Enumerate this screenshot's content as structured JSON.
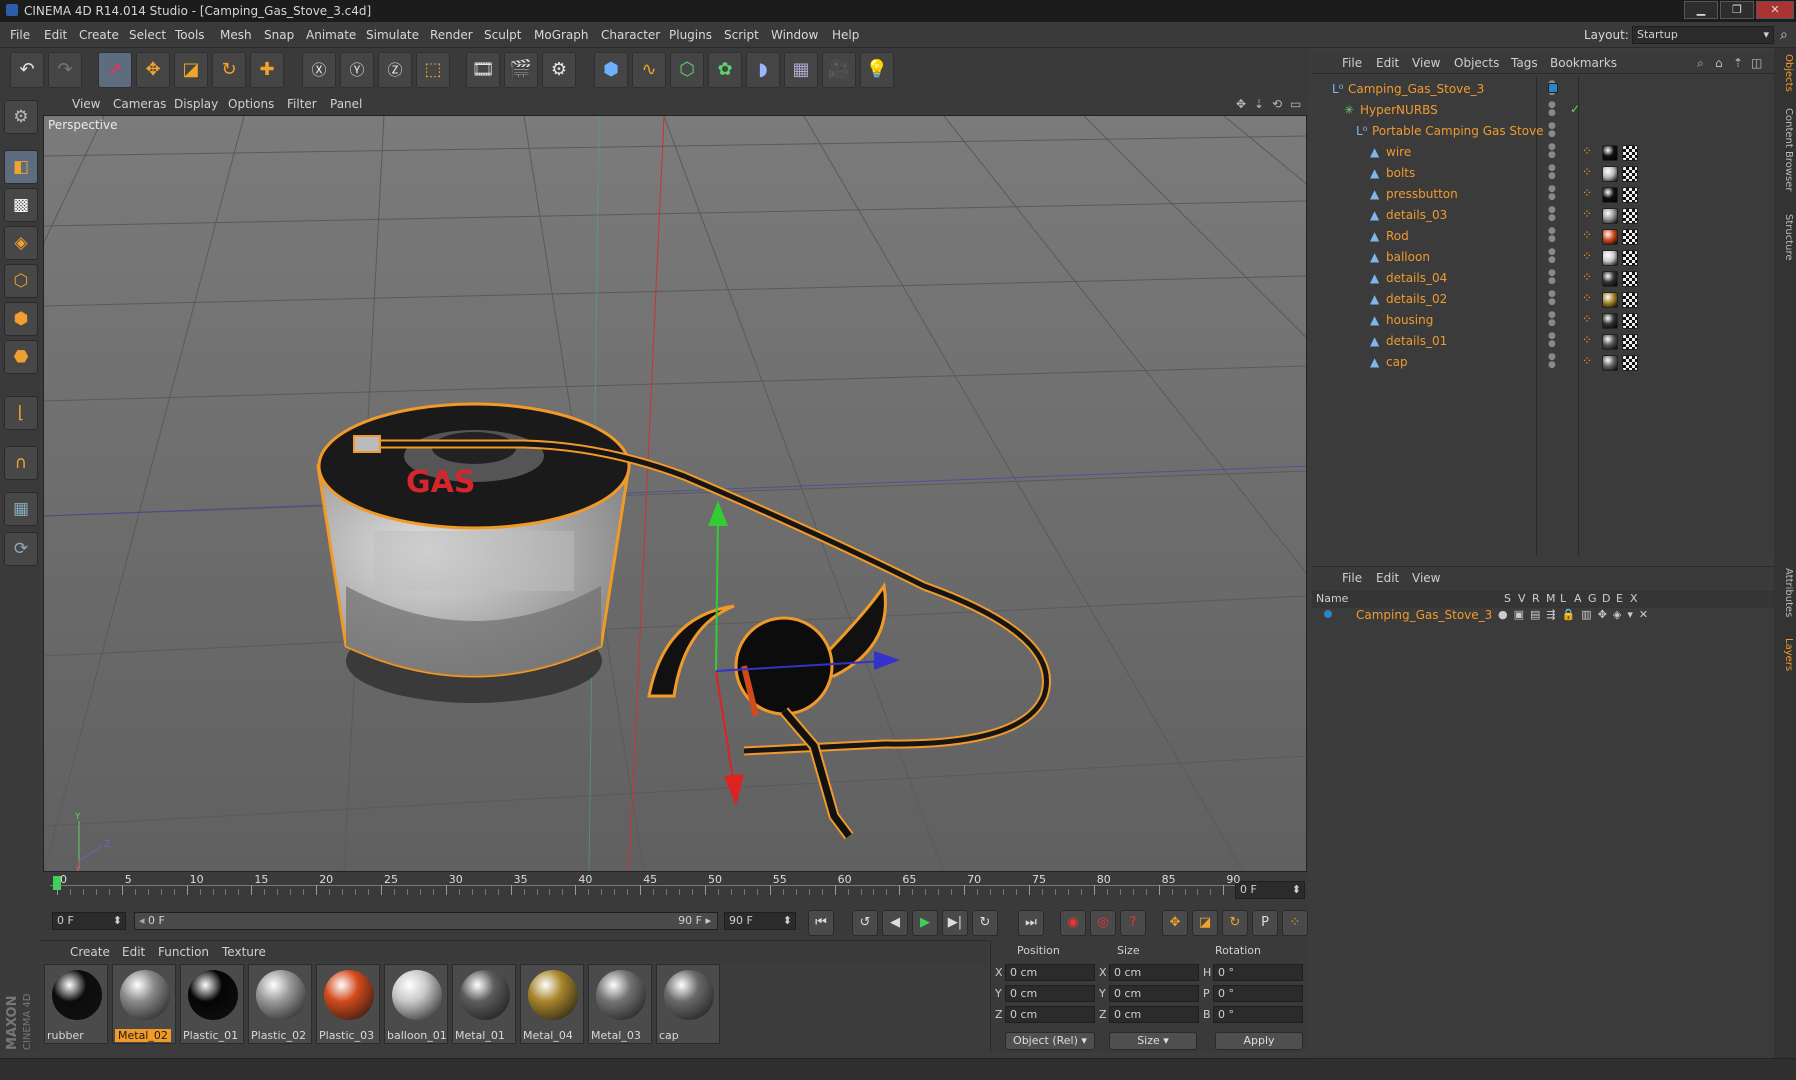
{
  "window": {
    "title": "CINEMA 4D R14.014 Studio - [Camping_Gas_Stove_3.c4d]",
    "layout_label": "Layout:",
    "layout_value": "Startup"
  },
  "menubar": [
    "File",
    "Edit",
    "Create",
    "Select",
    "Tools",
    "Mesh",
    "Snap",
    "Animate",
    "Simulate",
    "Render",
    "Sculpt",
    "MoGraph",
    "Character",
    "Plugins",
    "Script",
    "Window",
    "Help"
  ],
  "viewport": {
    "menu": [
      "View",
      "Cameras",
      "Display",
      "Options",
      "Filter",
      "Panel"
    ],
    "label": "Perspective",
    "can_text": "GAS",
    "axis_y": "Y",
    "axis_z": "Z",
    "axis_x": "X"
  },
  "timeline": {
    "ticks": [
      "0",
      "5",
      "10",
      "15",
      "20",
      "25",
      "30",
      "35",
      "40",
      "45",
      "50",
      "55",
      "60",
      "65",
      "70",
      "75",
      "80",
      "85",
      "90"
    ],
    "current_frame": "0 F",
    "start_frame": "0 F",
    "range_start": "0 F",
    "range_end": "90 F",
    "end_frame": "90 F"
  },
  "materials": {
    "menu": [
      "Create",
      "Edit",
      "Function",
      "Texture"
    ],
    "items": [
      {
        "name": "rubber",
        "color": "#0c0c0c",
        "selected": false
      },
      {
        "name": "Metal_02",
        "color": "#8a8a8a",
        "selected": true
      },
      {
        "name": "Plastic_01",
        "color": "#050505",
        "selected": false
      },
      {
        "name": "Plastic_02",
        "color": "#9a9a9a",
        "selected": false
      },
      {
        "name": "Plastic_03",
        "color": "#d24a1c",
        "selected": false
      },
      {
        "name": "balloon_01",
        "color": "#c9c9c9",
        "selected": false
      },
      {
        "name": "Metal_01",
        "color": "#5c5c5c",
        "selected": false
      },
      {
        "name": "Metal_04",
        "color": "#a8852a",
        "selected": false
      },
      {
        "name": "Metal_03",
        "color": "#737373",
        "selected": false
      },
      {
        "name": "cap",
        "color": "#6a6a6a",
        "selected": false
      }
    ]
  },
  "coordinates": {
    "headers": [
      "Position",
      "Size",
      "Rotation"
    ],
    "rows": [
      {
        "axis": "X",
        "pos": "0 cm",
        "saxis": "X",
        "size": "0 cm",
        "raxis": "H",
        "rot": "0 °"
      },
      {
        "axis": "Y",
        "pos": "0 cm",
        "saxis": "Y",
        "size": "0 cm",
        "raxis": "P",
        "rot": "0 °"
      },
      {
        "axis": "Z",
        "pos": "0 cm",
        "saxis": "Z",
        "size": "0 cm",
        "raxis": "B",
        "rot": "0 °"
      }
    ],
    "mode": "Object (Rel)",
    "size_mode": "Size",
    "apply": "Apply"
  },
  "object_manager": {
    "menu": [
      "File",
      "Edit",
      "View",
      "Objects",
      "Tags",
      "Bookmarks"
    ],
    "objects": [
      {
        "name": "Camping_Gas_Stove_3",
        "tag": ""
      },
      {
        "name": "HyperNURBS",
        "tag": ""
      },
      {
        "name": "Portable Camping Gas Stove",
        "tag": ""
      },
      {
        "name": "wire",
        "tag": "#111111"
      },
      {
        "name": "bolts",
        "tag": "#bbbbbb"
      },
      {
        "name": "pressbutton",
        "tag": "#111111"
      },
      {
        "name": "details_03",
        "tag": "#9a9a9a"
      },
      {
        "name": "Rod",
        "tag": "#d24a1c"
      },
      {
        "name": "balloon",
        "tag": "#cccccc"
      },
      {
        "name": "details_04",
        "tag": "#333333"
      },
      {
        "name": "details_02",
        "tag": "#a8852a"
      },
      {
        "name": "housing",
        "tag": "#333333"
      },
      {
        "name": "details_01",
        "tag": "#555555"
      },
      {
        "name": "cap",
        "tag": "#666666"
      }
    ]
  },
  "layer_manager": {
    "menu": [
      "File",
      "Edit",
      "View"
    ],
    "columns": [
      "Name",
      "S",
      "V",
      "R",
      "M",
      "L",
      "A",
      "G",
      "D",
      "E",
      "X"
    ],
    "rows": [
      {
        "name": "Camping_Gas_Stove_3"
      }
    ]
  },
  "side_tabs": [
    "Objects",
    "Content Browser",
    "Structure",
    "Attributes",
    "Layers"
  ],
  "colors": {
    "accent": "#f19a28",
    "selected_tool": "#5d6c7e"
  }
}
